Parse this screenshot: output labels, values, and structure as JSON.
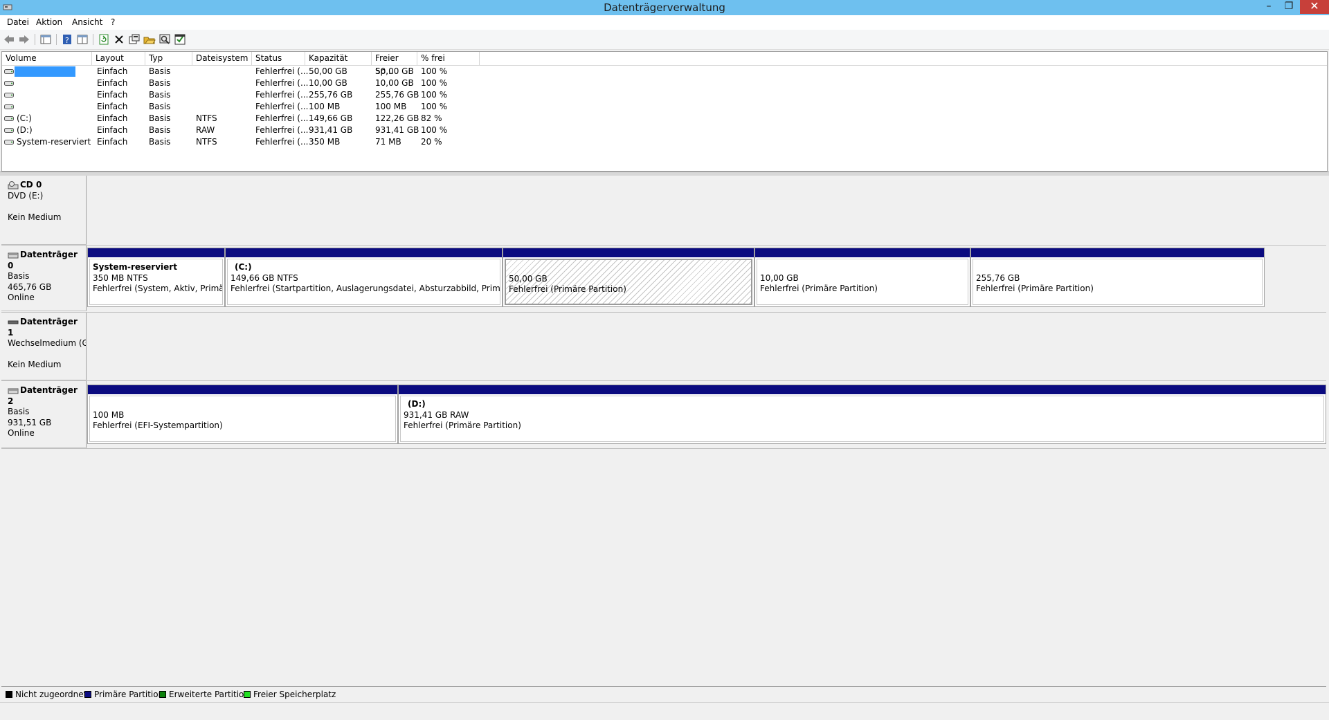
{
  "window": {
    "title": "Datenträgerverwaltung",
    "minimize": "–",
    "restore": "❐",
    "close": "✕"
  },
  "menu": [
    "Datei",
    "Aktion",
    "Ansicht",
    "?"
  ],
  "toolbar_icons": [
    "back-icon",
    "forward-icon",
    "console-tree-icon",
    "help-icon",
    "properties-view-icon",
    "refresh-icon",
    "delete-icon",
    "properties-icon",
    "open-icon",
    "explore-icon",
    "rescan-icon"
  ],
  "volume_table": {
    "headers": [
      "Volume",
      "Layout",
      "Typ",
      "Dateisystem",
      "Status",
      "Kapazität",
      "Freier Sp...",
      "% frei"
    ],
    "rows": [
      {
        "volume": "",
        "layout": "Einfach",
        "typ": "Basis",
        "dateisystem": "",
        "status": "Fehlerfrei (...",
        "kapazitaet": "50,00 GB",
        "frei": "50,00 GB",
        "prozent": "100 %",
        "selected": true
      },
      {
        "volume": "",
        "layout": "Einfach",
        "typ": "Basis",
        "dateisystem": "",
        "status": "Fehlerfrei (...",
        "kapazitaet": "10,00 GB",
        "frei": "10,00 GB",
        "prozent": "100 %"
      },
      {
        "volume": "",
        "layout": "Einfach",
        "typ": "Basis",
        "dateisystem": "",
        "status": "Fehlerfrei (...",
        "kapazitaet": "255,76 GB",
        "frei": "255,76 GB",
        "prozent": "100 %"
      },
      {
        "volume": "",
        "layout": "Einfach",
        "typ": "Basis",
        "dateisystem": "",
        "status": "Fehlerfrei (...",
        "kapazitaet": "100 MB",
        "frei": "100 MB",
        "prozent": "100 %"
      },
      {
        "volume": "(C:)",
        "layout": "Einfach",
        "typ": "Basis",
        "dateisystem": "NTFS",
        "status": "Fehlerfrei (...",
        "kapazitaet": "149,66 GB",
        "frei": "122,26 GB",
        "prozent": "82 %"
      },
      {
        "volume": "(D:)",
        "layout": "Einfach",
        "typ": "Basis",
        "dateisystem": "RAW",
        "status": "Fehlerfrei (...",
        "kapazitaet": "931,41 GB",
        "frei": "931,41 GB",
        "prozent": "100 %"
      },
      {
        "volume": "System-reserviert",
        "layout": "Einfach",
        "typ": "Basis",
        "dateisystem": "NTFS",
        "status": "Fehlerfrei (...",
        "kapazitaet": "350 MB",
        "frei": "71 MB",
        "prozent": "20 %"
      }
    ]
  },
  "disks": [
    {
      "name": "CD 0",
      "lines": [
        "DVD (E:)",
        "",
        "Kein Medium"
      ],
      "partitions": []
    },
    {
      "name": "Datenträger 0",
      "lines": [
        "Basis",
        "465,76 GB",
        "Online"
      ],
      "partitions": [
        {
          "title": "System-reserviert",
          "size": "350 MB NTFS",
          "status": "Fehlerfrei (System, Aktiv, Primäre P"
        },
        {
          "title": "(C:)",
          "size": "149,66 GB NTFS",
          "status": "Fehlerfrei (Startpartition, Auslagerungsdatei, Absturzabbild, Primäre Partit"
        },
        {
          "title": "",
          "size": "50,00 GB",
          "status": "Fehlerfrei (Primäre Partition)",
          "selected": true
        },
        {
          "title": "",
          "size": "10,00 GB",
          "status": "Fehlerfrei (Primäre Partition)"
        },
        {
          "title": "",
          "size": "255,76 GB",
          "status": "Fehlerfrei (Primäre Partition)"
        }
      ]
    },
    {
      "name": "Datenträger 1",
      "lines": [
        "Wechselmedium (G:",
        "",
        "Kein Medium"
      ],
      "partitions": []
    },
    {
      "name": "Datenträger 2",
      "lines": [
        "Basis",
        "931,51 GB",
        "Online"
      ],
      "partitions": [
        {
          "title": "",
          "size": "100 MB",
          "status": "Fehlerfrei (EFI-Systempartition)"
        },
        {
          "title": "(D:)",
          "size": "931,41 GB RAW",
          "status": "Fehlerfrei (Primäre Partition)"
        }
      ]
    }
  ],
  "legend": [
    {
      "label": "Nicht zugeordnet",
      "color": "#000000"
    },
    {
      "label": "Primäre Partition",
      "color": "#0b0b80"
    },
    {
      "label": "Erweiterte Partition",
      "color": "#0b800b"
    },
    {
      "label": "Freier Speicherplatz",
      "color": "#22e022"
    }
  ]
}
